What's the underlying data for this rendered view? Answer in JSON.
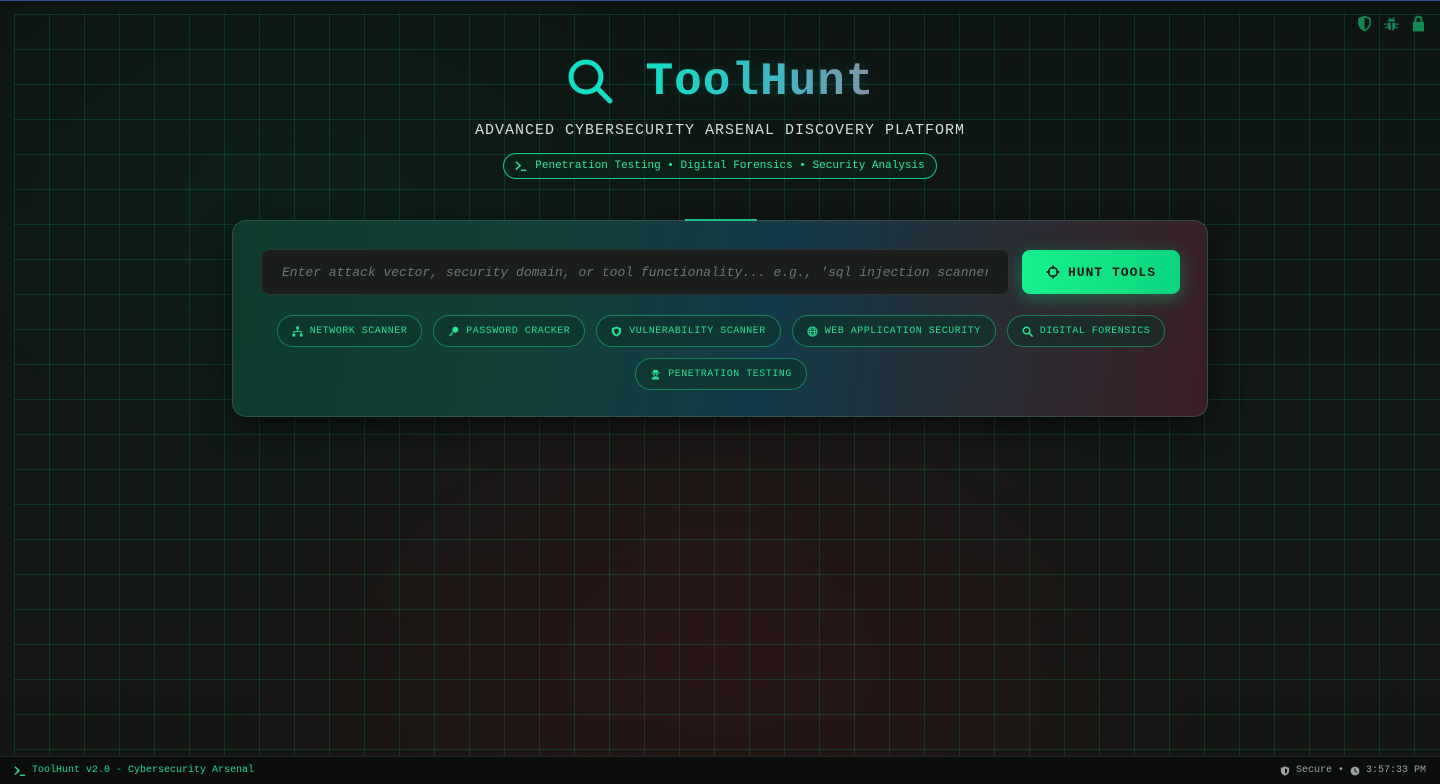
{
  "app": {
    "title": "ToolHunt",
    "subtitle": "ADVANCED CYBERSECURITY ARSENAL DISCOVERY PLATFORM",
    "tagline": "Penetration Testing • Digital Forensics • Security Analysis"
  },
  "corner_icons": [
    "shield-icon",
    "bug-icon",
    "lock-icon"
  ],
  "search": {
    "placeholder": "Enter attack vector, security domain, or tool functionality... e.g., 'sql injection scanner', 'network recon'",
    "value": "",
    "button_label": "HUNT TOOLS"
  },
  "categories": [
    {
      "label": "NETWORK SCANNER",
      "icon": "network-icon"
    },
    {
      "label": "PASSWORD CRACKER",
      "icon": "key-icon"
    },
    {
      "label": "VULNERABILITY SCANNER",
      "icon": "shield-icon"
    },
    {
      "label": "WEB APPLICATION SECURITY",
      "icon": "globe-icon"
    },
    {
      "label": "DIGITAL FORENSICS",
      "icon": "search-icon"
    },
    {
      "label": "PENETRATION TESTING",
      "icon": "user-secret-icon"
    }
  ],
  "footer": {
    "left_text": "ToolHunt v2.0 - Cybersecurity Arsenal",
    "status": "Secure",
    "separator": "•",
    "time": "3:57:33 PM"
  },
  "colors": {
    "accent": "#17f08e",
    "title_gradient_start": "#12e0c8",
    "title_gradient_end": "#8a8fa6",
    "grid": "#00c878"
  }
}
